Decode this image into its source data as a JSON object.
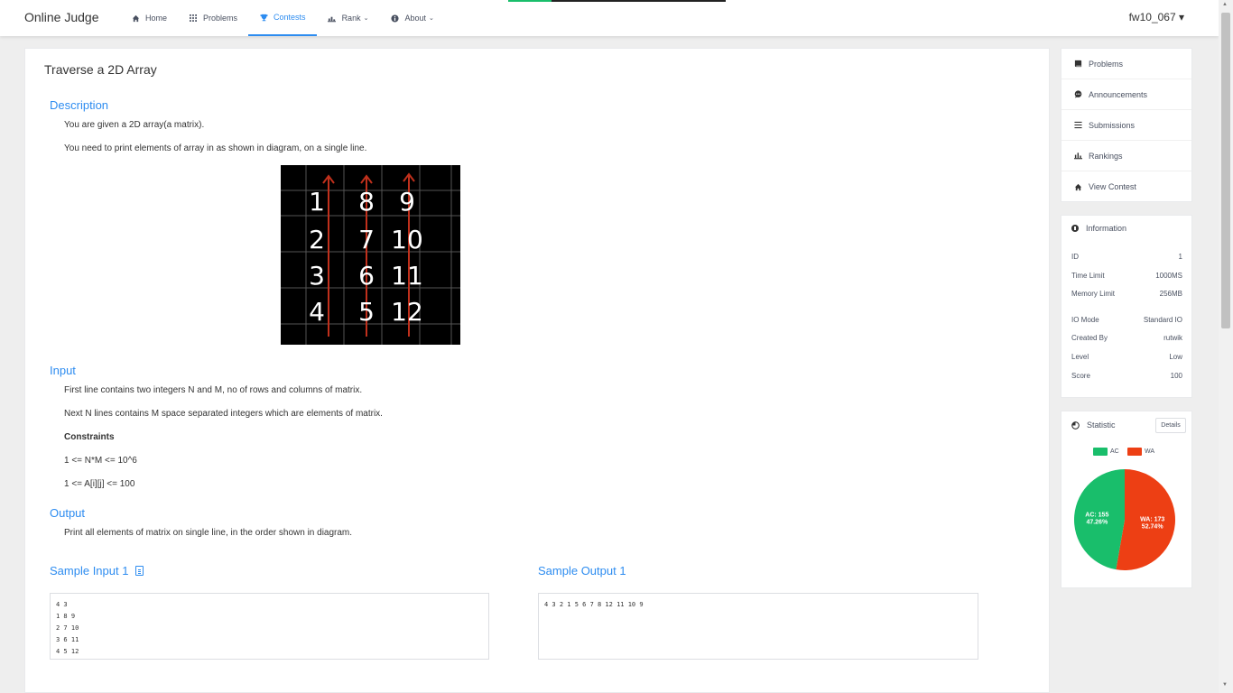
{
  "header": {
    "brand": "Online Judge",
    "nav": [
      {
        "label": "Home",
        "icon": "home-icon"
      },
      {
        "label": "Problems",
        "icon": "grid-icon"
      },
      {
        "label": "Contests",
        "icon": "trophy-icon",
        "active": true
      },
      {
        "label": "Rank",
        "icon": "bar-chart-icon",
        "dropdown": true
      },
      {
        "label": "About",
        "icon": "info-circle-icon",
        "dropdown": true
      }
    ],
    "user": "fw10_067 ▾"
  },
  "problem": {
    "title": "Traverse a 2D Array",
    "description_heading": "Description",
    "description": [
      "You are given a 2D array(a matrix).",
      "You need to print elements of array in as shown in diagram, on a single line."
    ],
    "diagram": {
      "grid": [
        [
          "1",
          "8",
          "9"
        ],
        [
          "2",
          "7",
          "10"
        ],
        [
          "3",
          "6",
          "11"
        ],
        [
          "4",
          "5",
          "12"
        ]
      ]
    },
    "input_heading": "Input",
    "input": [
      "First line contains two integers N and M, no of rows and columns of matrix.",
      "Next N lines contains M space separated integers which are elements of matrix."
    ],
    "constraints_heading": "Constraints",
    "constraints": [
      "1 <= N*M <= 10^6",
      "1 <= A[i][j] <= 100"
    ],
    "output_heading": "Output",
    "output": "Print all elements of matrix on single line, in the order shown in diagram.",
    "sample_input_title": "Sample Input 1",
    "sample_input_lines": [
      "4 3",
      "1 8 9",
      "2 7 10",
      "3 6 11",
      "4 5 12"
    ],
    "sample_output_title": "Sample Output 1",
    "sample_output": "4 3 2 1 5 6 7 8 12 11 10 9"
  },
  "sidebar": {
    "menu": [
      {
        "label": "Problems",
        "icon": "book-icon"
      },
      {
        "label": "Announcements",
        "icon": "chat-icon"
      },
      {
        "label": "Submissions",
        "icon": "list-icon"
      },
      {
        "label": "Rankings",
        "icon": "bar-chart-icon"
      },
      {
        "label": "View Contest",
        "icon": "home-icon"
      }
    ],
    "information": {
      "title": "Information",
      "rows": [
        {
          "label": "ID",
          "value": "1"
        },
        {
          "label": "Time Limit",
          "value": "1000MS"
        },
        {
          "label": "Memory Limit",
          "value": "256MB"
        },
        {
          "label": "IO Mode",
          "value": "Standard IO"
        },
        {
          "label": "Created By",
          "value": "rutwik"
        },
        {
          "label": "Level",
          "value": "Low"
        },
        {
          "label": "Score",
          "value": "100"
        }
      ]
    },
    "statistic": {
      "title": "Statistic",
      "details_label": "Details"
    }
  },
  "chart_data": {
    "type": "pie",
    "categories": [
      "AC",
      "WA"
    ],
    "values": [
      155,
      173
    ],
    "percents": [
      "47.26%",
      "52.74%"
    ],
    "colors": [
      "#19be6b",
      "#ed3f14"
    ],
    "slice_labels": [
      "AC: 155",
      "WA: 173"
    ],
    "legend": "top"
  }
}
